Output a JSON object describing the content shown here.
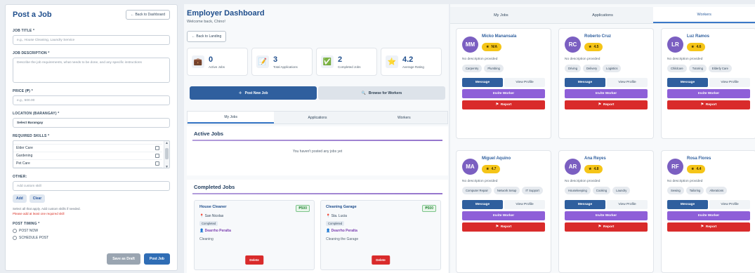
{
  "post_job": {
    "title": "Post a Job",
    "back": "← Back to Dashboard",
    "job_title_label": "JOB TITLE *",
    "job_title_placeholder": "e.g., House Cleaning, Laundry Service",
    "desc_label": "JOB DESCRIPTION *",
    "desc_placeholder": "Describe the job requirements, what needs to be done, and any specific instructions",
    "price_label": "PRICE (₱) *",
    "price_placeholder": "e.g., 500.00",
    "location_label": "LOCATION (BARANGAY) *",
    "location_value": "Select Barangay",
    "skills_label": "REQUIRED SKILLS *",
    "skills": [
      "Elder Care",
      "Gardening",
      "Pet Care"
    ],
    "other_label": "OTHER:",
    "other_placeholder": "Add custom skill",
    "add": "Add",
    "clear": "Clear",
    "hint": "Select all that apply. Add custom skills if needed.",
    "error": "Please add at least one required skill",
    "timing_label": "POST TIMING *",
    "post_now": "POST NOW",
    "schedule": "SCHEDULE POST",
    "draft": "Save as Draft",
    "post": "Post Job"
  },
  "dashboard": {
    "title": "Employer Dashboard",
    "welcome": "Welcome back, Chino!",
    "back": "← Back to Landing",
    "stats": [
      {
        "icon": "💼",
        "value": "0",
        "label": "Active Jobs"
      },
      {
        "icon": "📝",
        "value": "3",
        "label": "Total Applications"
      },
      {
        "icon": "✅",
        "value": "2",
        "label": "Completed Jobs"
      },
      {
        "icon": "⭐",
        "value": "4.2",
        "label": "Average Rating"
      }
    ],
    "post_new": "Post New Job",
    "browse": "Browse for Workers",
    "tabs": [
      "My Jobs",
      "Applications",
      "Workers"
    ],
    "active_title": "Active Jobs",
    "empty": "You haven't posted any jobs yet",
    "completed_title": "Completed Jobs",
    "jobs": [
      {
        "title": "House Cleaner",
        "price": "₱500",
        "loc": "San Nicolas",
        "badge": "Completed",
        "person": "Dearrho Peralta",
        "desc": "Cleaning",
        "delete": "Delete"
      },
      {
        "title": "Cleaning Garage",
        "price": "₱500",
        "loc": "Sta. Lucia",
        "badge": "Completed",
        "person": "Dearrho Peralta",
        "desc": "Cleaning the Garage",
        "delete": "Delete"
      }
    ]
  },
  "workers_view": {
    "tabs": [
      "My Jobs",
      "Applications",
      "Workers"
    ],
    "no_desc": "No description provided",
    "message": "Message",
    "view": "View Profile",
    "invite": "Invite Worker",
    "report": "Report",
    "workers": [
      {
        "initials": "MM",
        "name": "Micko Manansala",
        "rating": "N/A",
        "tags": [
          "Carpentry",
          "Plumbing"
        ]
      },
      {
        "initials": "RC",
        "name": "Roberto Cruz",
        "rating": "4.5",
        "tags": [
          "Driving",
          "Delivery",
          "Logistics"
        ]
      },
      {
        "initials": "LR",
        "name": "Luz Ramos",
        "rating": "4.6",
        "tags": [
          "Childcare",
          "Tutoring",
          "Elderly Care"
        ]
      },
      {
        "initials": "MA",
        "name": "Miguel Aquino",
        "rating": "4.7",
        "tags": [
          "Computer Repair",
          "Network Setup",
          "IT Support"
        ]
      },
      {
        "initials": "AR",
        "name": "Ana Reyes",
        "rating": "4.8",
        "tags": [
          "Housekeeping",
          "Cooking",
          "Laundry"
        ]
      },
      {
        "initials": "RF",
        "name": "Rosa Flores",
        "rating": "4.4",
        "tags": [
          "Sewing",
          "Tailoring",
          "Alterations"
        ]
      }
    ]
  }
}
